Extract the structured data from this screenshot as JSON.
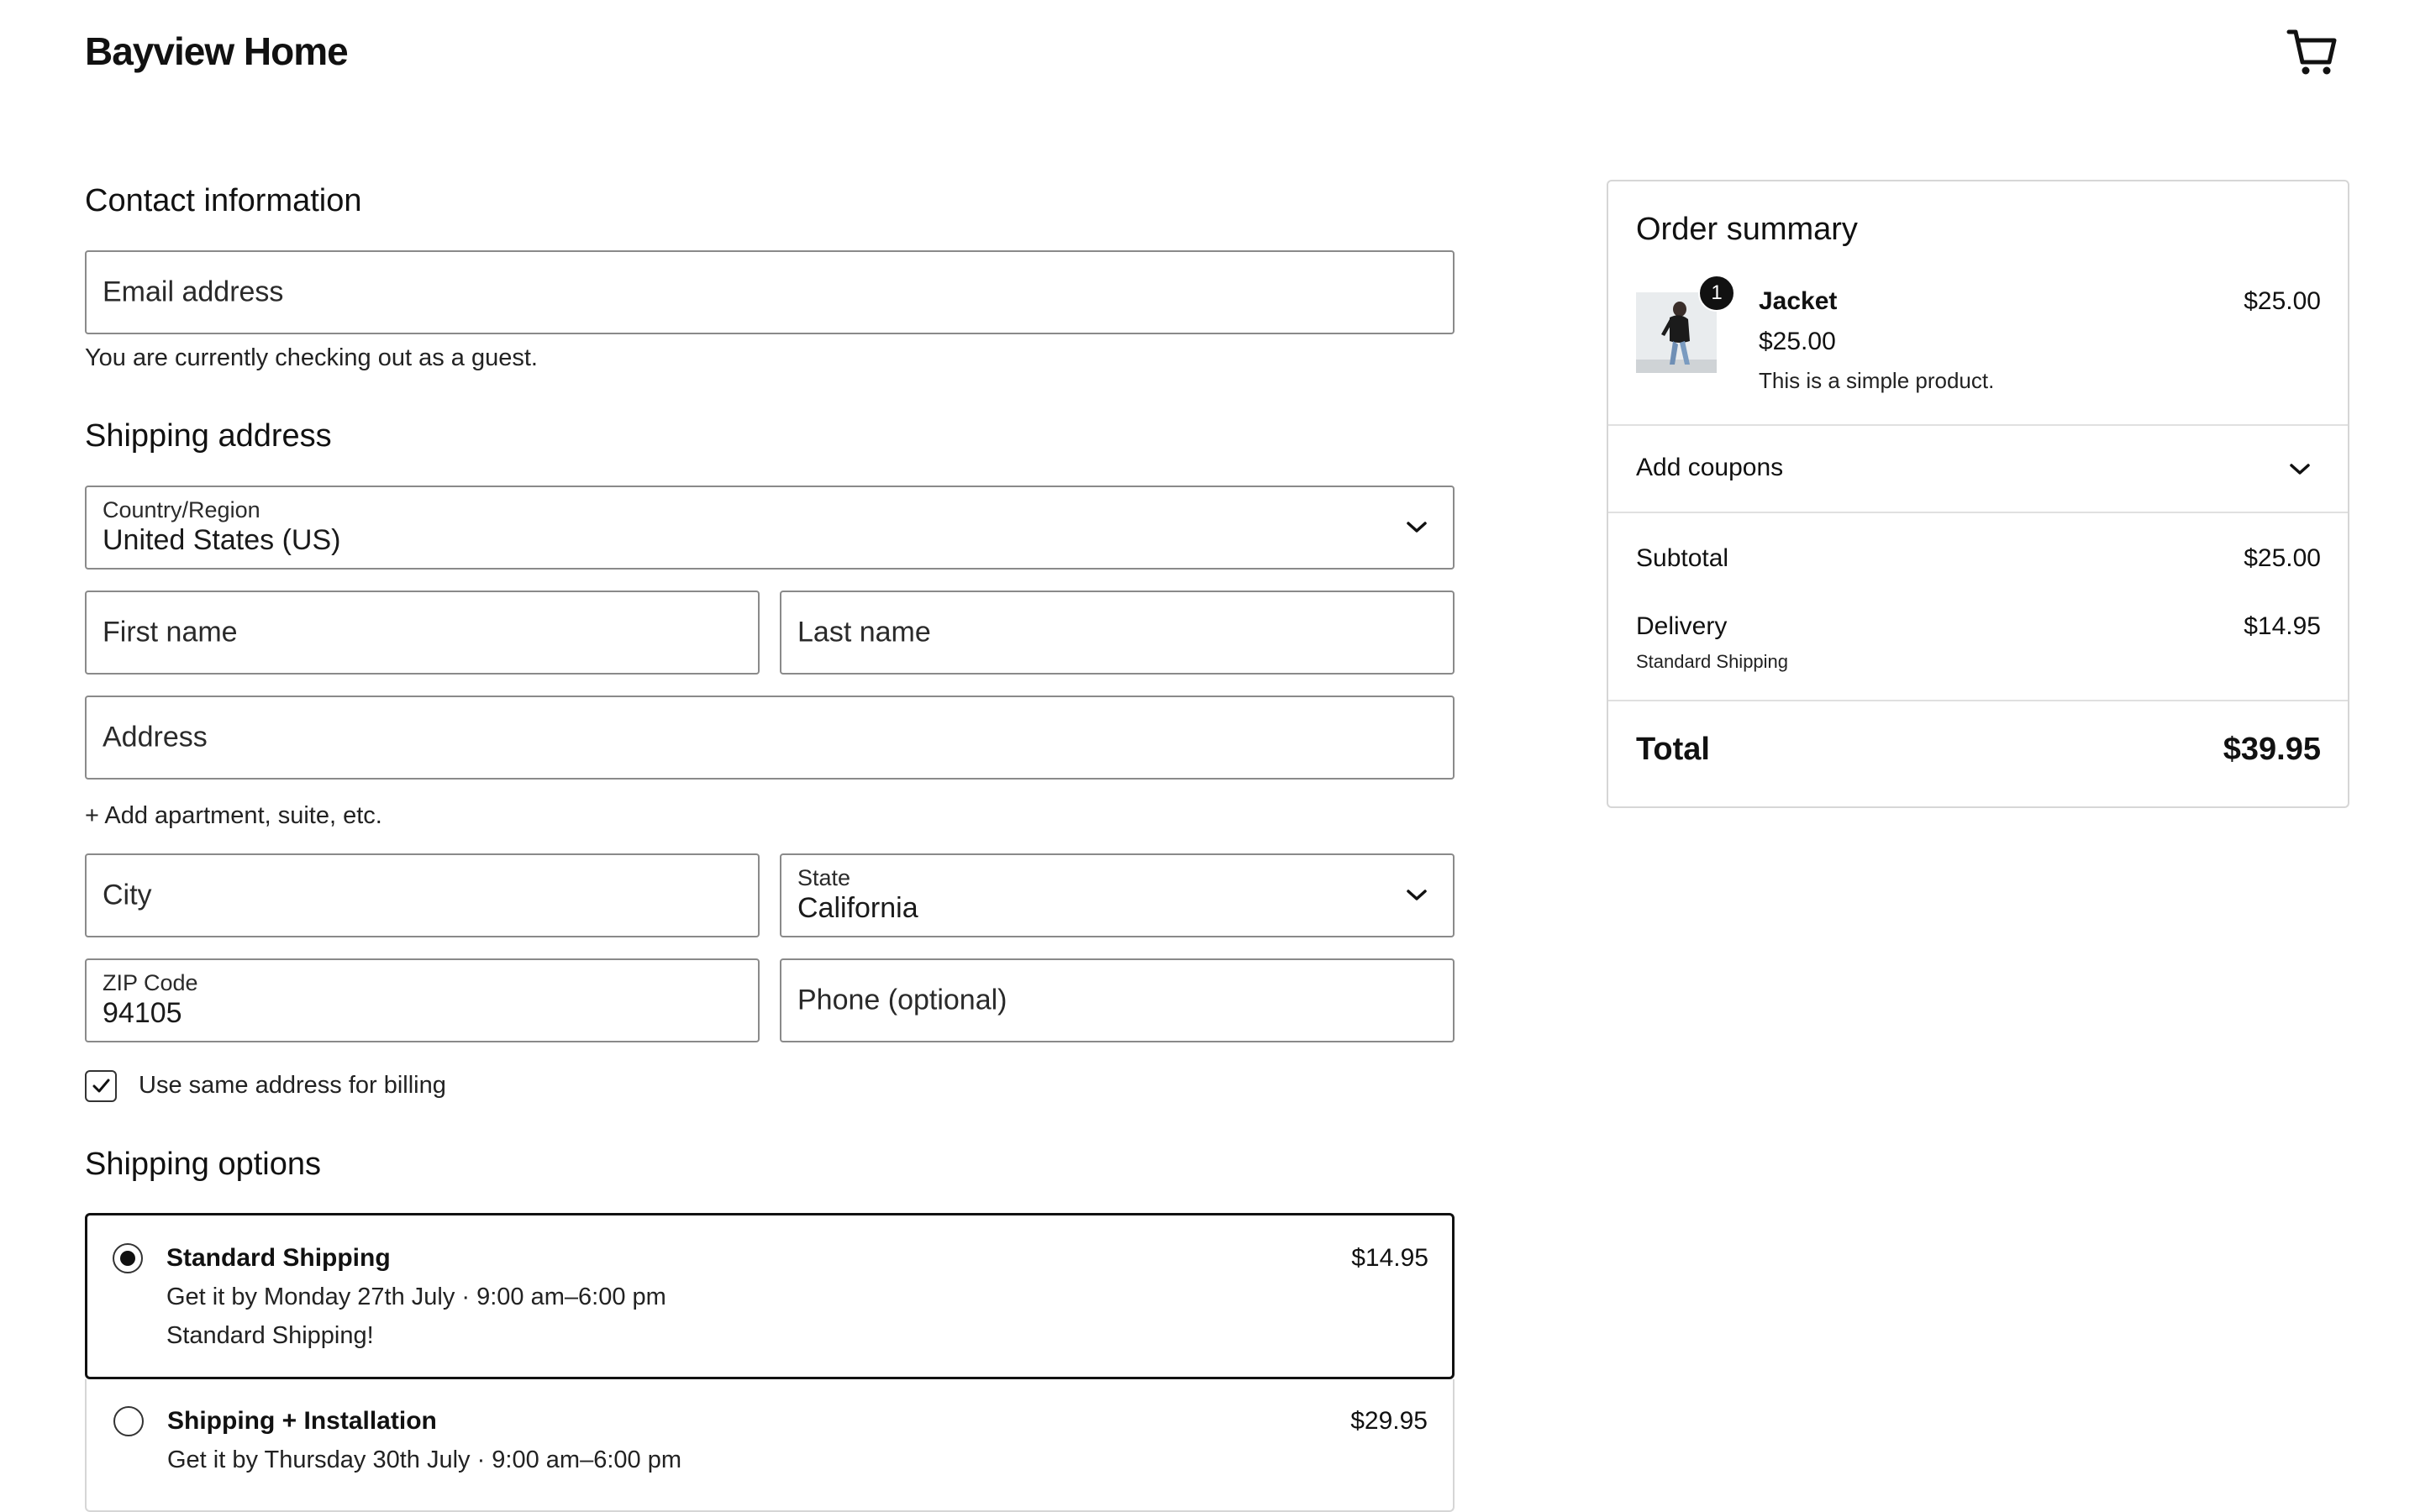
{
  "header": {
    "brand": "Bayview Home",
    "cart_icon": "cart-icon"
  },
  "contact": {
    "title": "Contact information",
    "email_placeholder": "Email address",
    "guest_note": "You are currently checking out as a guest."
  },
  "shipping_address": {
    "title": "Shipping address",
    "country_label": "Country/Region",
    "country_value": "United States (US)",
    "first_name_placeholder": "First name",
    "last_name_placeholder": "Last name",
    "address_placeholder": "Address",
    "add_apartment": "+ Add apartment, suite, etc.",
    "city_placeholder": "City",
    "state_label": "State",
    "state_value": "California",
    "zip_label": "ZIP Code",
    "zip_value": "94105",
    "phone_placeholder": "Phone (optional)",
    "billing_same_label": "Use same address for billing",
    "billing_same_checked": true
  },
  "shipping_options": {
    "title": "Shipping options",
    "options": [
      {
        "name": "Standard Shipping",
        "price": "$14.95",
        "eta": "Get it by Monday 27th July · 9:00 am–6:00 pm",
        "description": "Standard Shipping!",
        "selected": true
      },
      {
        "name": "Shipping + Installation",
        "price": "$29.95",
        "eta": "Get it by Thursday 30th July · 9:00 am–6:00 pm",
        "selected": false
      }
    ]
  },
  "order_summary": {
    "title": "Order summary",
    "item": {
      "name": "Jacket",
      "quantity_badge": "1",
      "unit_price": "$25.00",
      "line_price": "$25.00",
      "description": "This is a simple product."
    },
    "coupons_label": "Add coupons",
    "subtotal_label": "Subtotal",
    "subtotal_value": "$25.00",
    "delivery_label": "Delivery",
    "delivery_value": "$14.95",
    "delivery_method": "Standard Shipping",
    "total_label": "Total",
    "total_value": "$39.95"
  },
  "colors": {
    "text": "#111111",
    "border": "#8a8a8a",
    "selected_border": "#111111"
  }
}
